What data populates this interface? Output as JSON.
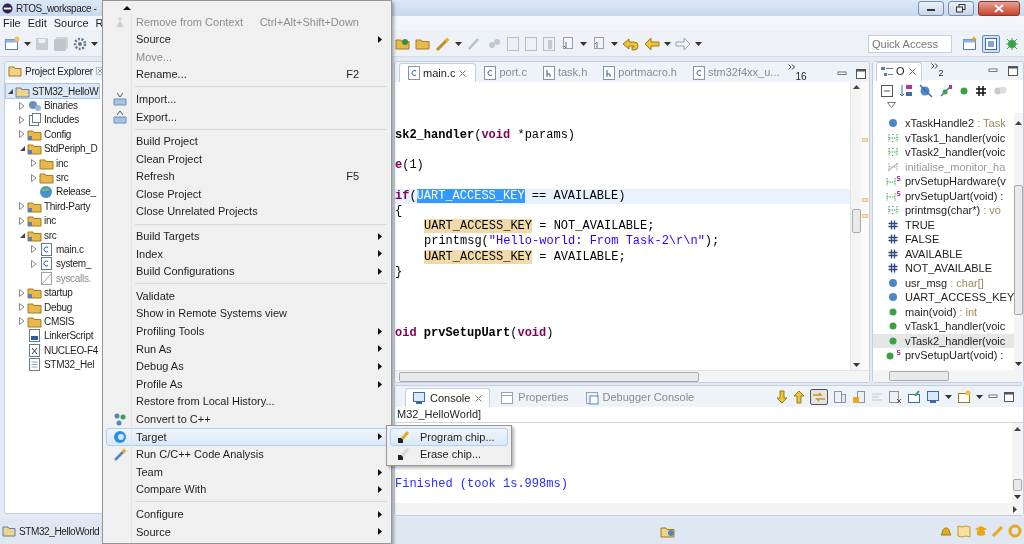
{
  "window": {
    "title": "RTOS_workspace -"
  },
  "menubar": [
    "File",
    "Edit",
    "Source",
    "R"
  ],
  "quick_access": {
    "placeholder": "Quick Access"
  },
  "project_explorer": {
    "title": "Project Explorer",
    "tree": [
      {
        "label": "STM32_HelloW",
        "kind": "project",
        "expanded": true,
        "selected": true,
        "children": [
          {
            "label": "Binaries",
            "kind": "binaries",
            "expanded": false,
            "selected": false
          },
          {
            "label": "Includes",
            "kind": "includes",
            "expanded": false,
            "selected": false
          },
          {
            "label": "Config",
            "kind": "srcfolder",
            "expanded": false,
            "selected": false
          },
          {
            "label": "StdPeriph_D",
            "kind": "srcfolder",
            "expanded": true,
            "selected": false,
            "children": [
              {
                "label": "inc",
                "kind": "folder",
                "expanded": false,
                "selected": false
              },
              {
                "label": "src",
                "kind": "folder",
                "expanded": false,
                "selected": false
              },
              {
                "label": "Release_",
                "kind": "webfile",
                "selected": false
              }
            ]
          },
          {
            "label": "Third-Party",
            "kind": "srcfolder",
            "expanded": false,
            "selected": false
          },
          {
            "label": "inc",
            "kind": "srcfolder",
            "expanded": false,
            "selected": false
          },
          {
            "label": "src",
            "kind": "srcfolder",
            "expanded": true,
            "selected": false,
            "children": [
              {
                "label": "main.c",
                "kind": "cfile",
                "expanded": false,
                "selected": false
              },
              {
                "label": "system_",
                "kind": "cfile",
                "expanded": false,
                "selected": false
              },
              {
                "label": "syscalls.",
                "kind": "excluded",
                "selected": false
              }
            ]
          },
          {
            "label": "startup",
            "kind": "srcfolder",
            "expanded": false,
            "selected": false
          },
          {
            "label": "Debug",
            "kind": "folder",
            "expanded": false,
            "selected": false
          },
          {
            "label": "CMSIS",
            "kind": "folder",
            "expanded": false,
            "selected": false
          },
          {
            "label": "LinkerScript",
            "kind": "linker",
            "selected": false
          },
          {
            "label": "NUCLEO-F4",
            "kind": "xmlfile",
            "selected": false
          },
          {
            "label": "STM32_Hel",
            "kind": "textfile",
            "selected": false
          }
        ]
      }
    ]
  },
  "editor": {
    "tabs": [
      {
        "label": "main.c",
        "kind": "c",
        "selected": true
      },
      {
        "label": "port.c",
        "kind": "c",
        "selected": false
      },
      {
        "label": "task.h",
        "kind": "h",
        "selected": false
      },
      {
        "label": "portmacro.h",
        "kind": "h",
        "selected": false
      },
      {
        "label": "stm32f4xx_u...",
        "kind": "c",
        "selected": false
      }
    ],
    "overflow_count": "16",
    "blocks": [
      [
        {
          "current": false,
          "indented": false,
          "segments": [
            {
              "text": "sk2_handler",
              "kind": "declaration"
            },
            {
              "text": "(",
              "kind": "plain"
            },
            {
              "text": "void",
              "kind": "keyword"
            },
            {
              "text": " *params)",
              "kind": "plain"
            }
          ]
        }
      ],
      [
        {
          "current": false,
          "indented": false,
          "segments": [
            {
              "text": "e",
              "kind": "keyword"
            },
            {
              "text": "(1)",
              "kind": "plain"
            }
          ]
        }
      ],
      [
        {
          "current": true,
          "indented": false,
          "segments": [
            {
              "text": "if",
              "kind": "keyword"
            },
            {
              "text": "(",
              "kind": "plain"
            },
            {
              "text": "UART_ACCESS_KEY",
              "kind": "selection"
            },
            {
              "text": " == AVAILABLE)",
              "kind": "plain"
            }
          ]
        },
        {
          "current": false,
          "indented": false,
          "segments": [
            {
              "text": "{",
              "kind": "plain"
            }
          ]
        },
        {
          "current": false,
          "indented": true,
          "segments": [
            {
              "text": "UART_ACCESS_KEY",
              "kind": "occurrence"
            },
            {
              "text": " = NOT_AVAILABLE;",
              "kind": "plain"
            }
          ]
        },
        {
          "current": false,
          "indented": true,
          "segments": [
            {
              "text": "printmsg(",
              "kind": "plain"
            },
            {
              "text": "\"Hello-world: From Task-2\\r\\n\"",
              "kind": "string"
            },
            {
              "text": ");",
              "kind": "plain"
            }
          ]
        },
        {
          "current": false,
          "indented": true,
          "segments": [
            {
              "text": "UART_ACCESS_KEY",
              "kind": "occurrence"
            },
            {
              "text": " = AVAILABLE;",
              "kind": "plain"
            }
          ]
        },
        {
          "current": false,
          "indented": false,
          "segments": [
            {
              "text": "}",
              "kind": "plain"
            }
          ]
        }
      ],
      [
        {
          "current": false,
          "indented": false,
          "segments": [
            {
              "text": "oid",
              "kind": "keyword"
            },
            {
              "text": " prvSetupUart",
              "kind": "declaration"
            },
            {
              "text": "(",
              "kind": "plain"
            },
            {
              "text": "void",
              "kind": "keyword"
            },
            {
              "text": ")",
              "kind": "plain"
            }
          ]
        }
      ]
    ]
  },
  "outline": {
    "tabs": [
      {
        "label": "O",
        "selected": true
      }
    ],
    "overflow_count": "2",
    "items": [
      {
        "name": "xTaskHandle2",
        "type": " : Task",
        "kind": "field",
        "selected": false
      },
      {
        "name": "vTask1_handler(voic",
        "kind": "function",
        "selected": false
      },
      {
        "name": "vTask2_handler(voic",
        "kind": "function",
        "selected": false
      },
      {
        "name": "initialise_monitor_ha",
        "kind": "inactive",
        "selected": false
      },
      {
        "name": "prvSetupHardware(v",
        "kind": "staticfunction",
        "selected": false
      },
      {
        "name": "prvSetupUart(void) :",
        "kind": "staticfunction",
        "selected": false
      },
      {
        "name": "printmsg(char*)",
        "type": " : vo",
        "kind": "function",
        "selected": false
      },
      {
        "name": "TRUE",
        "kind": "macro",
        "selected": false
      },
      {
        "name": "FALSE",
        "kind": "macro",
        "selected": false
      },
      {
        "name": "AVAILABLE",
        "kind": "macro",
        "selected": false
      },
      {
        "name": "NOT_AVAILABLE",
        "kind": "macro",
        "selected": false
      },
      {
        "name": "usr_msg",
        "type": " : char[]",
        "kind": "field",
        "selected": false
      },
      {
        "name": "UART_ACCESS_KEY",
        "kind": "field",
        "selected": false
      },
      {
        "name": "main(void)",
        "type": " : int",
        "kind": "impl",
        "selected": false
      },
      {
        "name": "vTask1_handler(voic",
        "kind": "impl",
        "selected": false
      },
      {
        "name": "vTask2_handler(voic",
        "kind": "impl",
        "selected": true
      },
      {
        "name": "prvSetupUart(void) :",
        "kind": "staticimpl",
        "selected": false
      }
    ]
  },
  "console": {
    "tabs": [
      {
        "label": "Console",
        "selected": true
      },
      {
        "label": "Properties",
        "selected": false
      },
      {
        "label": "Debugger Console",
        "selected": false
      }
    ],
    "header": "M32_HelloWorld]",
    "lines": [
      "Finished (took 1s.998ms)"
    ]
  },
  "status_bar": {
    "project": "STM32_HelloWorld"
  },
  "context_menu": {
    "sections": [
      [
        {
          "label": "Remove from Context",
          "shortcut": "Ctrl+Alt+Shift+Down",
          "kind": "remove",
          "submenu": false,
          "disabled": true,
          "selected": false
        },
        {
          "label": "Source",
          "kind": "plain",
          "submenu": true,
          "disabled": false,
          "selected": false
        },
        {
          "label": "Move...",
          "kind": "plain",
          "submenu": false,
          "disabled": true,
          "selected": false
        },
        {
          "label": "Rename...",
          "shortcut": "F2",
          "kind": "plain",
          "submenu": false,
          "disabled": false,
          "selected": false
        }
      ],
      [
        {
          "label": "Import...",
          "kind": "import",
          "submenu": false,
          "disabled": false,
          "selected": false
        },
        {
          "label": "Export...",
          "kind": "export",
          "submenu": false,
          "disabled": false,
          "selected": false
        }
      ],
      [
        {
          "label": "Build Project",
          "kind": "plain",
          "submenu": false,
          "disabled": false,
          "selected": false
        },
        {
          "label": "Clean Project",
          "kind": "plain",
          "submenu": false,
          "disabled": false,
          "selected": false
        },
        {
          "label": "Refresh",
          "shortcut": "F5",
          "kind": "plain",
          "submenu": false,
          "disabled": false,
          "selected": false
        },
        {
          "label": "Close Project",
          "kind": "plain",
          "submenu": false,
          "disabled": false,
          "selected": false
        },
        {
          "label": "Close Unrelated Projects",
          "kind": "plain",
          "submenu": false,
          "disabled": false,
          "selected": false
        }
      ],
      [
        {
          "label": "Build Targets",
          "kind": "plain",
          "submenu": true,
          "disabled": false,
          "selected": false
        },
        {
          "label": "Index",
          "kind": "plain",
          "submenu": true,
          "disabled": false,
          "selected": false
        },
        {
          "label": "Build Configurations",
          "kind": "plain",
          "submenu": true,
          "disabled": false,
          "selected": false
        }
      ],
      [
        {
          "label": "Validate",
          "kind": "plain",
          "submenu": false,
          "disabled": false,
          "selected": false
        },
        {
          "label": "Show in Remote Systems view",
          "kind": "plain",
          "submenu": false,
          "disabled": false,
          "selected": false
        },
        {
          "label": "Profiling Tools",
          "kind": "plain",
          "submenu": true,
          "disabled": false,
          "selected": false
        },
        {
          "label": "Run As",
          "kind": "plain",
          "submenu": true,
          "disabled": false,
          "selected": false
        },
        {
          "label": "Debug As",
          "kind": "plain",
          "submenu": true,
          "disabled": false,
          "selected": false
        },
        {
          "label": "Profile As",
          "kind": "plain",
          "submenu": true,
          "disabled": false,
          "selected": false
        },
        {
          "label": "Restore from Local History...",
          "kind": "plain",
          "submenu": false,
          "disabled": false,
          "selected": false
        },
        {
          "label": "Convert to C++",
          "kind": "convert",
          "submenu": false,
          "disabled": false,
          "selected": false
        },
        {
          "label": "Target",
          "kind": "target",
          "submenu": true,
          "disabled": false,
          "selected": true
        },
        {
          "label": "Run C/C++ Code Analysis",
          "kind": "analysis",
          "submenu": false,
          "disabled": false,
          "selected": false
        },
        {
          "label": "Team",
          "kind": "plain",
          "submenu": true,
          "disabled": false,
          "selected": false
        },
        {
          "label": "Compare With",
          "kind": "plain",
          "submenu": true,
          "disabled": false,
          "selected": false
        }
      ],
      [
        {
          "label": "Configure",
          "kind": "plain",
          "submenu": true,
          "disabled": false,
          "selected": false
        },
        {
          "label": "Source",
          "kind": "plain",
          "submenu": true,
          "disabled": false,
          "selected": false
        }
      ]
    ]
  },
  "submenu": {
    "items": [
      {
        "label": "Program chip...",
        "kind": "program",
        "selected": true
      },
      {
        "label": "Erase chip...",
        "kind": "erase",
        "selected": false
      }
    ]
  }
}
